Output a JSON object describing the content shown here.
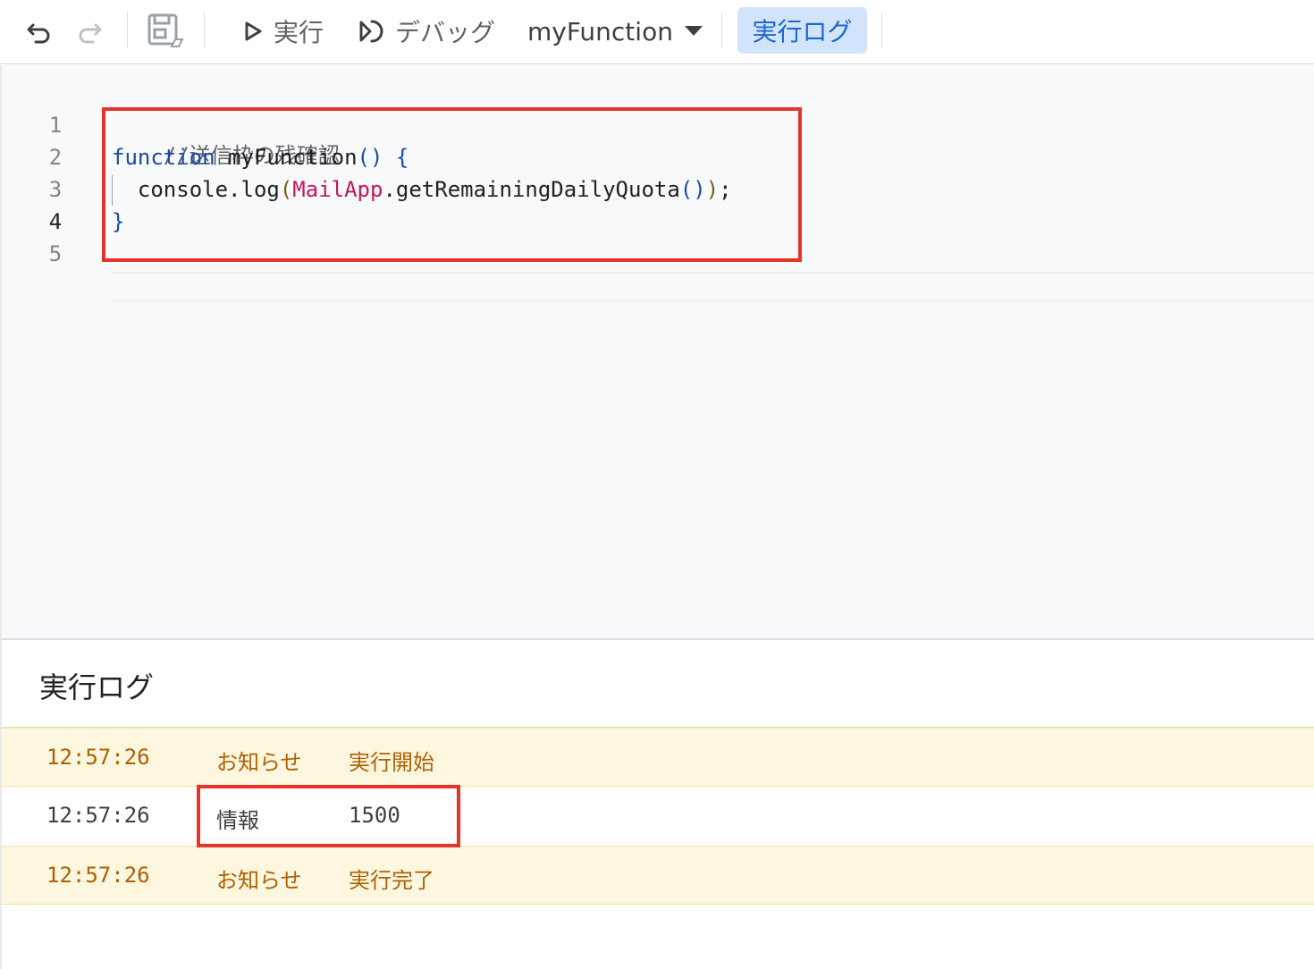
{
  "toolbar": {
    "undo_icon": "undo-icon",
    "redo_icon": "redo-icon",
    "save_icon": "save-drive-icon",
    "run_label": "実行",
    "run_icon": "play-icon",
    "debug_label": "デバッグ",
    "debug_icon": "debug-icon",
    "function_select": "myFunction",
    "execution_log_label": "実行ログ",
    "accent_color": "#d2e3fc"
  },
  "editor": {
    "line_numbers": [
      "1",
      "2",
      "3",
      "4",
      "5"
    ],
    "code": {
      "line1_comment": "//送信枠の残確認",
      "line2_keyword": "function",
      "line2_name": " myFunction",
      "line2_parens": "()",
      "line2_space": " ",
      "line2_brace": "{",
      "line3_indent": "  console.log",
      "line3_open": "(",
      "line3_class": "MailApp",
      "line3_method": ".getRemainingDailyQuota",
      "line3_inner": "()",
      "line3_close": ")",
      "line3_semicolon": ";",
      "line4_brace": "}"
    }
  },
  "log_panel": {
    "title": "実行ログ",
    "rows": [
      {
        "time": "12:57:26",
        "type": "お知らせ",
        "message": "実行開始"
      },
      {
        "time": "12:57:26",
        "type": "情報",
        "message": "1500"
      },
      {
        "time": "12:57:26",
        "type": "お知らせ",
        "message": "実行完了"
      }
    ]
  },
  "colors": {
    "highlight_box": "#e53528",
    "notice_row_bg": "#fef7e0",
    "notice_text": "#b06000"
  }
}
